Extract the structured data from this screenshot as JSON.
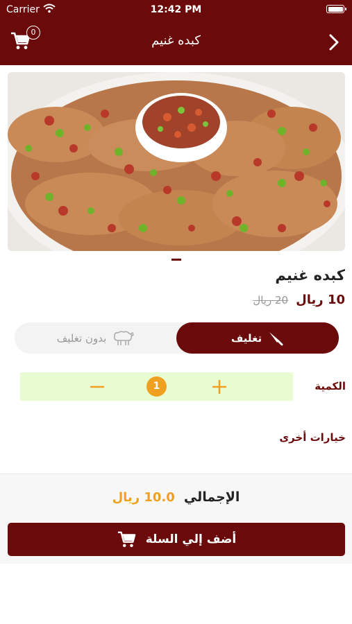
{
  "status_bar": {
    "carrier": "Carrier",
    "time": "12:42 PM"
  },
  "nav": {
    "title": "كبده غنيم",
    "cart_count": "0"
  },
  "product": {
    "name": "كبده غنيم",
    "price_new": "10 ريال",
    "price_old": "20 ريال",
    "image_icon": "food-photo"
  },
  "options": {
    "wrapped": "تغليف",
    "unwrapped": "بدون تغليف",
    "selected": "wrapped"
  },
  "quantity": {
    "label": "الكمية",
    "value": "1"
  },
  "other_options": "خيارات أخرى",
  "total": {
    "label": "الإجمالي",
    "value": "10.0 ريال"
  },
  "add_to_cart": "أضف إلي السلة",
  "colors": {
    "brand": "#6b0a0a",
    "accent": "#f0a020",
    "stepper_bg": "#e9fbd0"
  }
}
